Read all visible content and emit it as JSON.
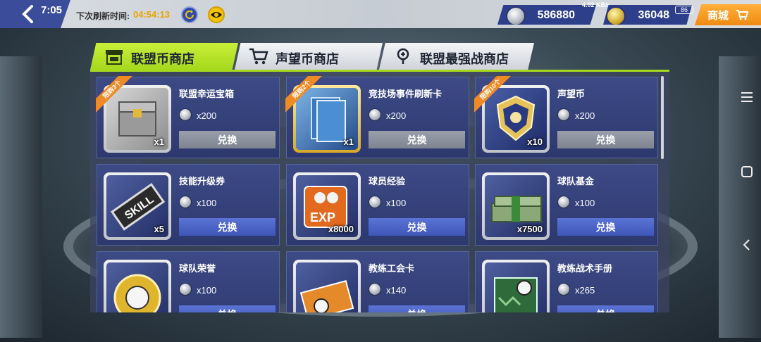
{
  "status": {
    "time": "7:05",
    "network": "4.02 KB/s",
    "battery": "86"
  },
  "topbar": {
    "refresh_label": "下次刷新时间:",
    "refresh_time": "04:54:13",
    "currency_1": "586880",
    "currency_2": "36048",
    "shop_label": "商城"
  },
  "tabs": [
    {
      "label": "联盟币商店",
      "active": true
    },
    {
      "label": "声望币商店",
      "active": false
    },
    {
      "label": "联盟最强战商店",
      "active": false
    }
  ],
  "items": [
    {
      "name": "联盟幸运宝箱",
      "price": "x200",
      "qty": "x1",
      "ribbon": "限购3个",
      "button": "兑换",
      "enabled": false
    },
    {
      "name": "竞技场事件刷新卡",
      "price": "x200",
      "qty": "x1",
      "ribbon": "限购2个",
      "button": "兑换",
      "enabled": false
    },
    {
      "name": "声望币",
      "price": "x200",
      "qty": "x10",
      "ribbon": "限购10个",
      "button": "兑换",
      "enabled": false
    },
    {
      "name": "技能升级券",
      "price": "x100",
      "qty": "x5",
      "ribbon": "",
      "button": "兑换",
      "enabled": true
    },
    {
      "name": "球员经验",
      "price": "x100",
      "qty": "x8000",
      "ribbon": "",
      "button": "兑换",
      "enabled": true
    },
    {
      "name": "球队基金",
      "price": "x100",
      "qty": "x7500",
      "ribbon": "",
      "button": "兑换",
      "enabled": true
    },
    {
      "name": "球队荣誉",
      "price": "x100",
      "qty": "",
      "ribbon": "",
      "button": "兑换",
      "enabled": true
    },
    {
      "name": "教练工会卡",
      "price": "x140",
      "qty": "",
      "ribbon": "",
      "button": "兑换",
      "enabled": true
    },
    {
      "name": "教练战术手册",
      "price": "x265",
      "qty": "",
      "ribbon": "",
      "button": "兑换",
      "enabled": true
    }
  ],
  "colors": {
    "accent_green": "#a6d81c",
    "panel_blue": "#2d386d",
    "button_blue": "#3e56b8",
    "orange": "#f08a12"
  }
}
